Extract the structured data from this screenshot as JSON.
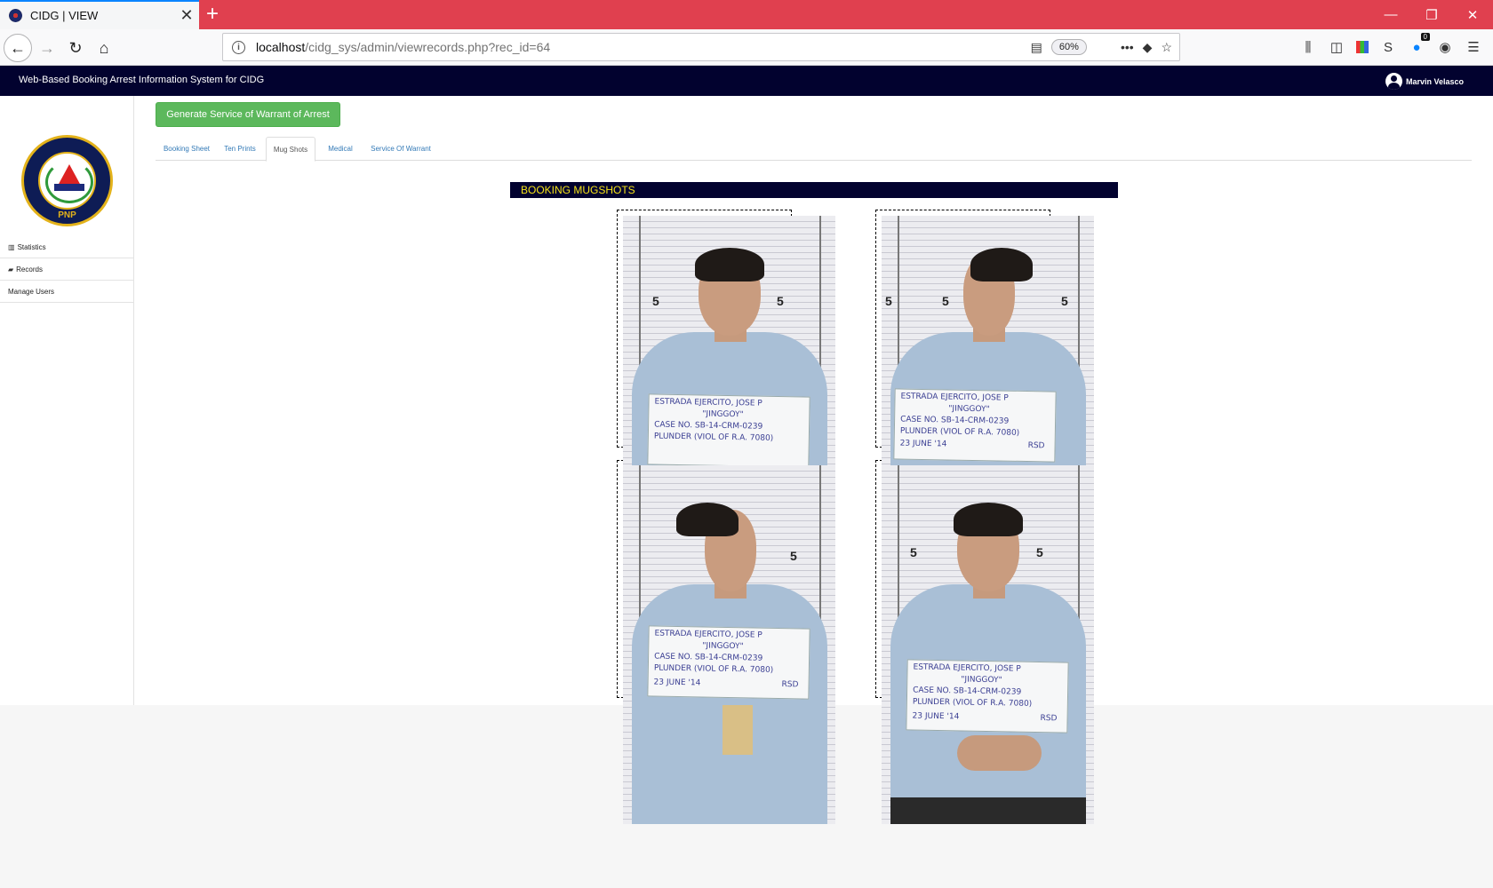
{
  "browser": {
    "tab_title": "CIDG | VIEW",
    "url_host": "localhost",
    "url_path": "/cidg_sys/admin/viewrecords.php?rec_id=64",
    "zoom": "60%",
    "notification_count": "0"
  },
  "app": {
    "title": "Web-Based Booking Arrest Information System for CIDG",
    "user_name": "Marvin Velasco",
    "logo_text": "PNP",
    "generate_button": "Generate Service of Warrant of Arrest"
  },
  "sidebar": {
    "items": [
      {
        "label": "Statistics",
        "icon": "bar-chart-icon"
      },
      {
        "label": "Records",
        "icon": "folder-icon"
      },
      {
        "label": "Manage Users",
        "icon": ""
      }
    ]
  },
  "tabs": [
    {
      "label": "Booking Sheet"
    },
    {
      "label": "Ten Prints"
    },
    {
      "label": "Mug Shots",
      "active": true
    },
    {
      "label": "Medical"
    },
    {
      "label": "Service Of Warrant"
    }
  ],
  "mugshots": {
    "heading": "BOOKING MUGSHOTS",
    "placard": {
      "line1": "ESTRADA EJERCITO, JOSE P",
      "line2": "\"JINGGOY\"",
      "line3": "CASE NO. SB-14-CRM-0239",
      "line4": "PLUNDER (VIOL OF R.A. 7080)",
      "line5": "23 JUNE '14",
      "line6": "RSD"
    },
    "scale_mark": "5"
  },
  "colors": {
    "tabstrip": "#e0404f",
    "appbar": "#02022f",
    "heading_text": "#f4e21a",
    "button": "#5cb85c"
  }
}
